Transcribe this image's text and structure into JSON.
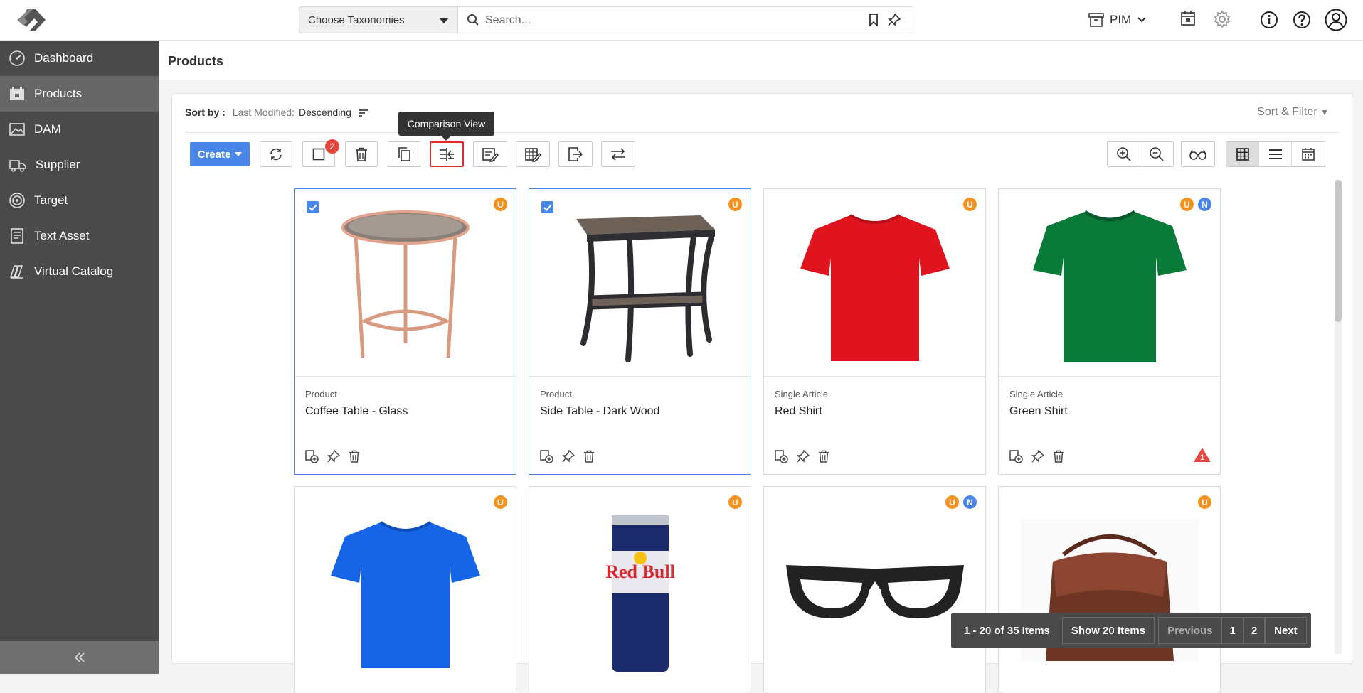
{
  "header": {
    "taxonomy_label": "Choose Taxonomies",
    "search_placeholder": "Search...",
    "module_label": "PIM"
  },
  "sidebar": {
    "items": [
      {
        "label": "Dashboard",
        "icon": "dashboard-icon"
      },
      {
        "label": "Products",
        "icon": "products-icon"
      },
      {
        "label": "DAM",
        "icon": "image-icon"
      },
      {
        "label": "Supplier",
        "icon": "truck-icon"
      },
      {
        "label": "Target",
        "icon": "target-icon"
      },
      {
        "label": "Text Asset",
        "icon": "document-icon"
      },
      {
        "label": "Virtual Catalog",
        "icon": "catalog-icon"
      }
    ],
    "active": "Products"
  },
  "page": {
    "title": "Products"
  },
  "sort": {
    "label": "Sort by :",
    "field": "Last Modified:",
    "direction": "Descending",
    "filter_label": "Sort & Filter"
  },
  "toolbar": {
    "create_label": "Create",
    "selected_count": "2",
    "tooltip": "Comparison View"
  },
  "products": [
    {
      "type": "Product",
      "name": "Coffee Table - Glass",
      "selected": true,
      "badges": [
        "U"
      ],
      "warning": ""
    },
    {
      "type": "Product",
      "name": "Side Table - Dark Wood",
      "selected": true,
      "badges": [
        "U"
      ],
      "warning": ""
    },
    {
      "type": "Single Article",
      "name": "Red Shirt",
      "selected": false,
      "badges": [
        "U"
      ],
      "warning": ""
    },
    {
      "type": "Single Article",
      "name": "Green Shirt",
      "selected": false,
      "badges": [
        "U",
        "N"
      ],
      "warning": "1"
    },
    {
      "type": "",
      "name": "",
      "selected": false,
      "badges": [
        "U"
      ],
      "warning": ""
    },
    {
      "type": "",
      "name": "",
      "selected": false,
      "badges": [
        "U"
      ],
      "warning": ""
    },
    {
      "type": "",
      "name": "",
      "selected": false,
      "badges": [
        "U",
        "N"
      ],
      "warning": ""
    },
    {
      "type": "",
      "name": "",
      "selected": false,
      "badges": [
        "U"
      ],
      "warning": ""
    }
  ],
  "pagination": {
    "range": "1 - 20 of 35 Items",
    "show": "Show 20 Items",
    "previous": "Previous",
    "pages": [
      "1",
      "2"
    ],
    "next": "Next"
  },
  "colors": {
    "accent": "#4a86e8",
    "sidebar": "#4a4a4a",
    "badge_u": "#f5921e",
    "badge_n": "#4a86e8",
    "warning": "#e8453c"
  }
}
